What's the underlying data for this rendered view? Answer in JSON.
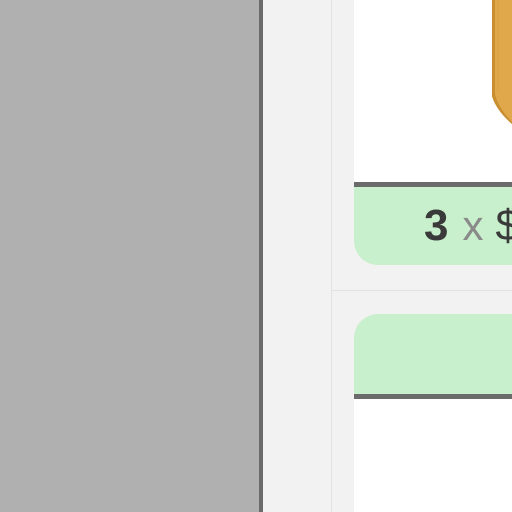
{
  "price_banner": {
    "quantity": "3",
    "times": "x",
    "price": "$"
  },
  "cta_banner": {
    "label": ""
  },
  "colors": {
    "left_panel": "#b0b0b0",
    "banner_green": "#c8f0cc",
    "bar_dark": "#6b6b6b",
    "box_orange": "#e0a84a"
  },
  "icons": {
    "product_image": "cardboard-box-image"
  }
}
